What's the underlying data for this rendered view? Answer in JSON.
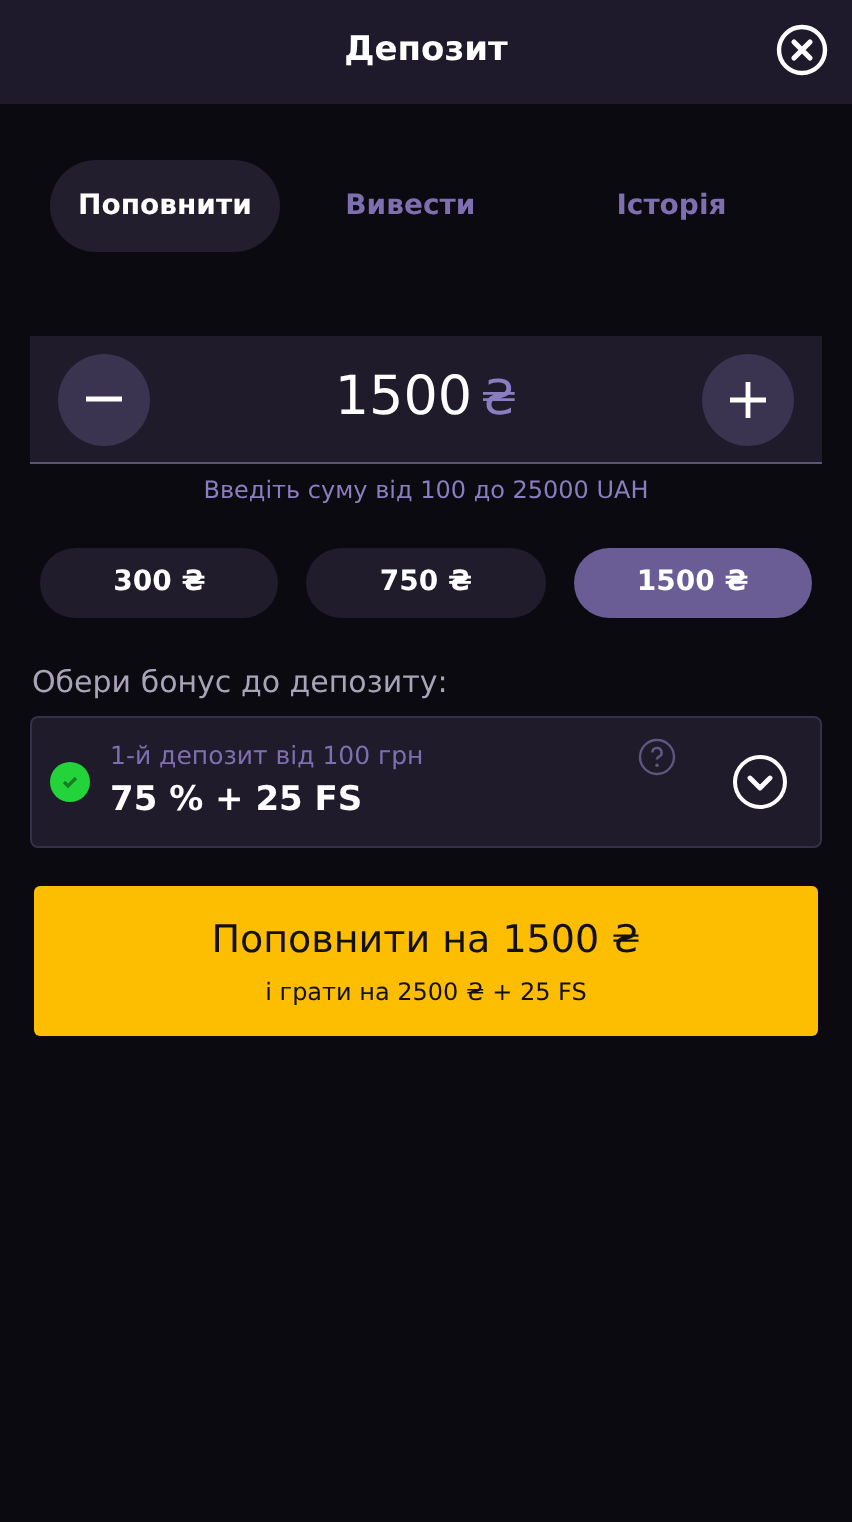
{
  "window": {
    "title": "Депозит"
  },
  "tabs": [
    {
      "label": "Поповнити",
      "selected": true
    },
    {
      "label": "Вивести",
      "selected": false
    },
    {
      "label": "Історія",
      "selected": false
    }
  ],
  "amount": {
    "value": "1500",
    "currency": "₴",
    "hint": "Введіть суму від 100 до 25000 UAH"
  },
  "presets": [
    {
      "label": "300 ₴",
      "selected": false
    },
    {
      "label": "750 ₴",
      "selected": false
    },
    {
      "label": "1500 ₴",
      "selected": true
    }
  ],
  "bonus": {
    "label": "Обери бонус до депозиту:",
    "caption": "1-й депозит від 100 грн",
    "value": "75 % + 25 FS",
    "checked": true
  },
  "deposit_button": {
    "label": "Поповнити на 1500 ₴",
    "sublabel": "і грати на 2500 ₴ + 25 FS"
  }
}
